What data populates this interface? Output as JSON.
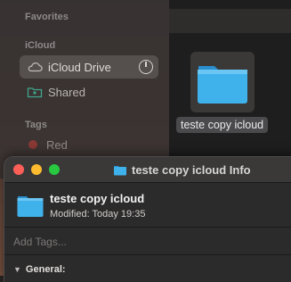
{
  "sidebar": {
    "favorites_heading": "Favorites",
    "icloud_heading": "iCloud",
    "items": [
      {
        "label": "iCloud Drive",
        "icon": "cloud-icon"
      },
      {
        "label": "Shared",
        "icon": "shared-folder-icon"
      }
    ],
    "tags_heading": "Tags",
    "tags": [
      {
        "label": "Red",
        "color": "#8a3a35"
      }
    ]
  },
  "main": {
    "file": {
      "name": "teste copy icloud",
      "icon": "folder-icon"
    }
  },
  "info_window": {
    "title": "teste copy icloud Info",
    "name": "teste copy icloud",
    "modified_label": "Modified:",
    "modified_value": "Today 19:35",
    "tags_placeholder": "Add Tags...",
    "general_label": "General:"
  },
  "colors": {
    "folder": "#3fb2ec",
    "close": "#fe5f57",
    "minimize": "#febc2e",
    "zoom": "#28c840"
  }
}
